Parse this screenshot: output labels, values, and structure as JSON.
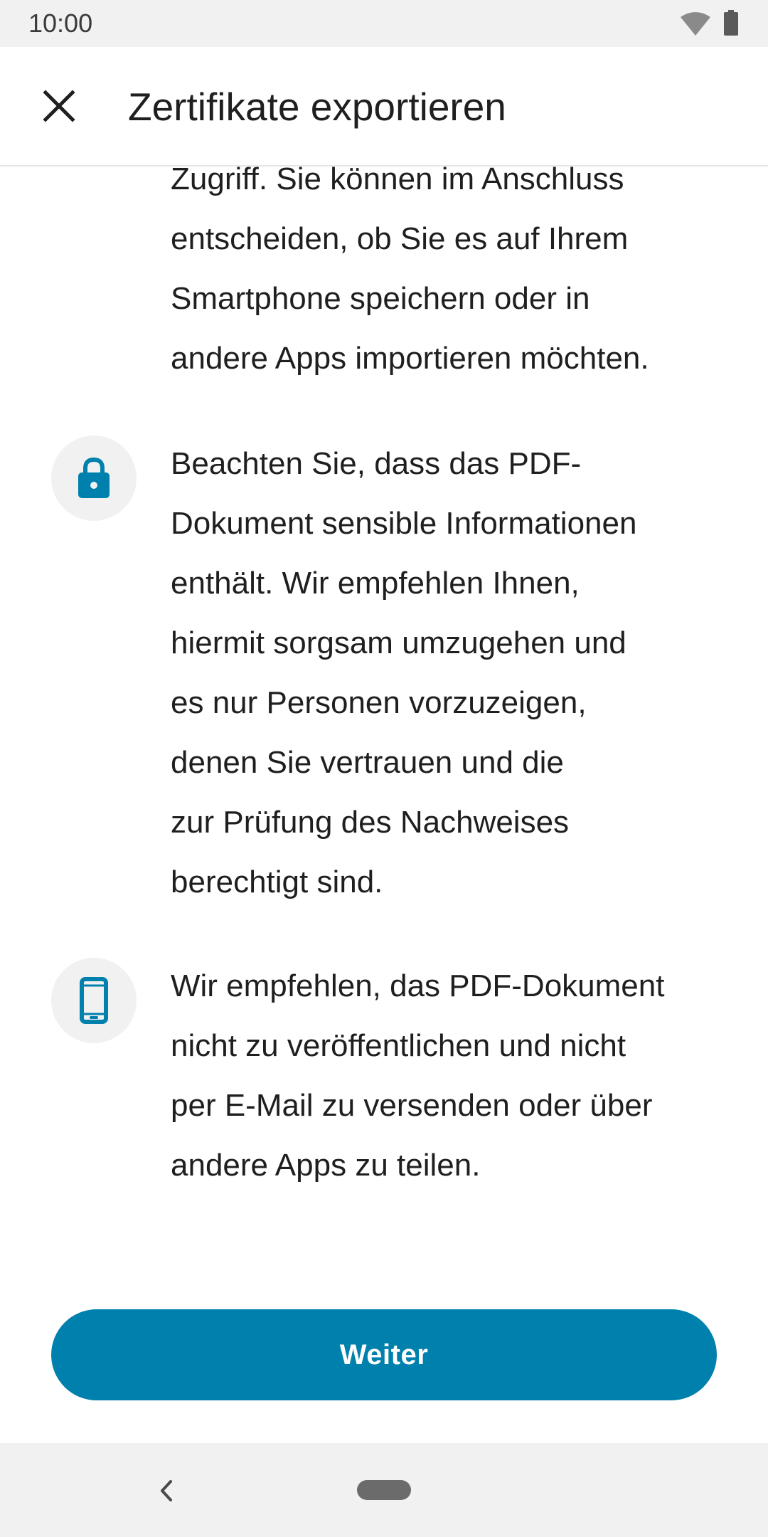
{
  "status_bar": {
    "time": "10:00",
    "icons": [
      "wifi-icon",
      "battery-icon"
    ]
  },
  "app_bar": {
    "close_icon": "close-icon",
    "title": "Zertifikate exportieren"
  },
  "content": {
    "paragraph_1": {
      "lines": [
        "Zugriff. Sie können im Anschluss",
        "entscheiden, ob Sie es auf Ihrem",
        "Smartphone speichern oder in",
        "andere Apps importieren möchten."
      ]
    },
    "paragraph_2": {
      "icon": "lock-icon",
      "lines": [
        "Beachten Sie, dass das PDF-",
        "Dokument sensible Informationen",
        "enthält. Wir empfehlen Ihnen,",
        "hiermit sorgsam umzugehen und",
        "es nur Personen vorzuzeigen,",
        "denen Sie vertrauen und die",
        "zur Prüfung des Nachweises",
        "berechtigt sind."
      ]
    },
    "paragraph_3": {
      "icon": "smartphone-icon",
      "lines": [
        "Wir empfehlen, das PDF-Dokument",
        "nicht zu veröffentlichen und nicht",
        "per E-Mail zu versenden oder über",
        "andere Apps zu teilen."
      ]
    }
  },
  "primary_button": {
    "label": "Weiter"
  },
  "colors": {
    "accent": "#0080ad",
    "icon_circle_bg": "#f1f1f1",
    "status_bar_bg": "#f1f1f1",
    "text": "#1f1f1f"
  },
  "nav_bar": {
    "icons": [
      "back-icon",
      "home-pill-icon"
    ]
  }
}
